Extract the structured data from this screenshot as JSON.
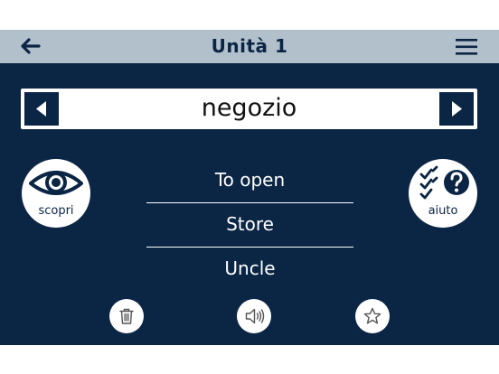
{
  "header": {
    "title": "Unità 1",
    "back_icon": "arrow-left-icon",
    "menu_icon": "hamburger-menu-icon"
  },
  "flashcard": {
    "word": "negozio",
    "prev_icon": "triangle-left-icon",
    "next_icon": "triangle-right-icon"
  },
  "discover_button": {
    "label": "scopri",
    "icon": "eye-icon"
  },
  "help_button": {
    "label": "aiuto",
    "icon": "checklist-question-icon"
  },
  "answers": [
    "To open",
    "Store",
    "Uncle"
  ],
  "actions": {
    "trash_icon": "trash-icon",
    "sound_icon": "speaker-icon",
    "star_icon": "star-outline-icon"
  },
  "colors": {
    "header_bg": "#b2c0cb",
    "main_bg": "#0b2545",
    "accent": "#ffffff"
  }
}
